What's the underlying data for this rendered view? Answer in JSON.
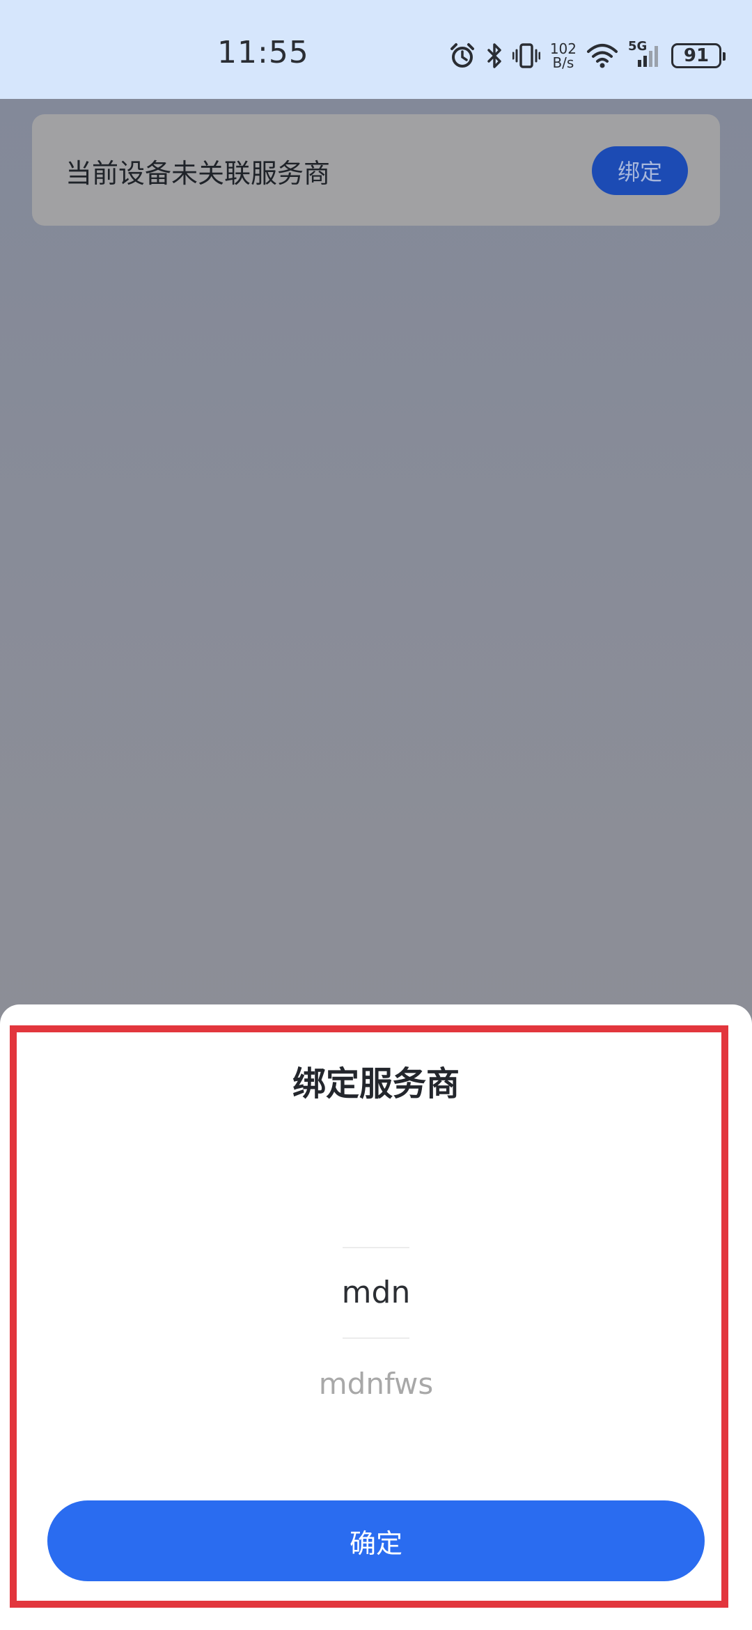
{
  "status_bar": {
    "time": "11:55",
    "net_speed_value": "102",
    "net_speed_unit": "B/s",
    "network_type": "5G",
    "battery": "91",
    "icons": [
      "alarm-icon",
      "bluetooth-icon",
      "vibrate-icon",
      "wifi-icon",
      "cellular-signal-icon",
      "battery-icon"
    ]
  },
  "device_card": {
    "message": "当前设备未关联服务商",
    "bind_label": "绑定"
  },
  "bind_sheet": {
    "title": "绑定服务商",
    "options": [
      "mdn",
      "mdnfws"
    ],
    "selected": "mdn",
    "confirm_label": "确定"
  },
  "colors": {
    "status_bar_bg": "#d6e6fc",
    "bind_button": "#1c4bb4",
    "confirm_button": "#2a6cf0",
    "highlight_frame": "#e2363d"
  }
}
